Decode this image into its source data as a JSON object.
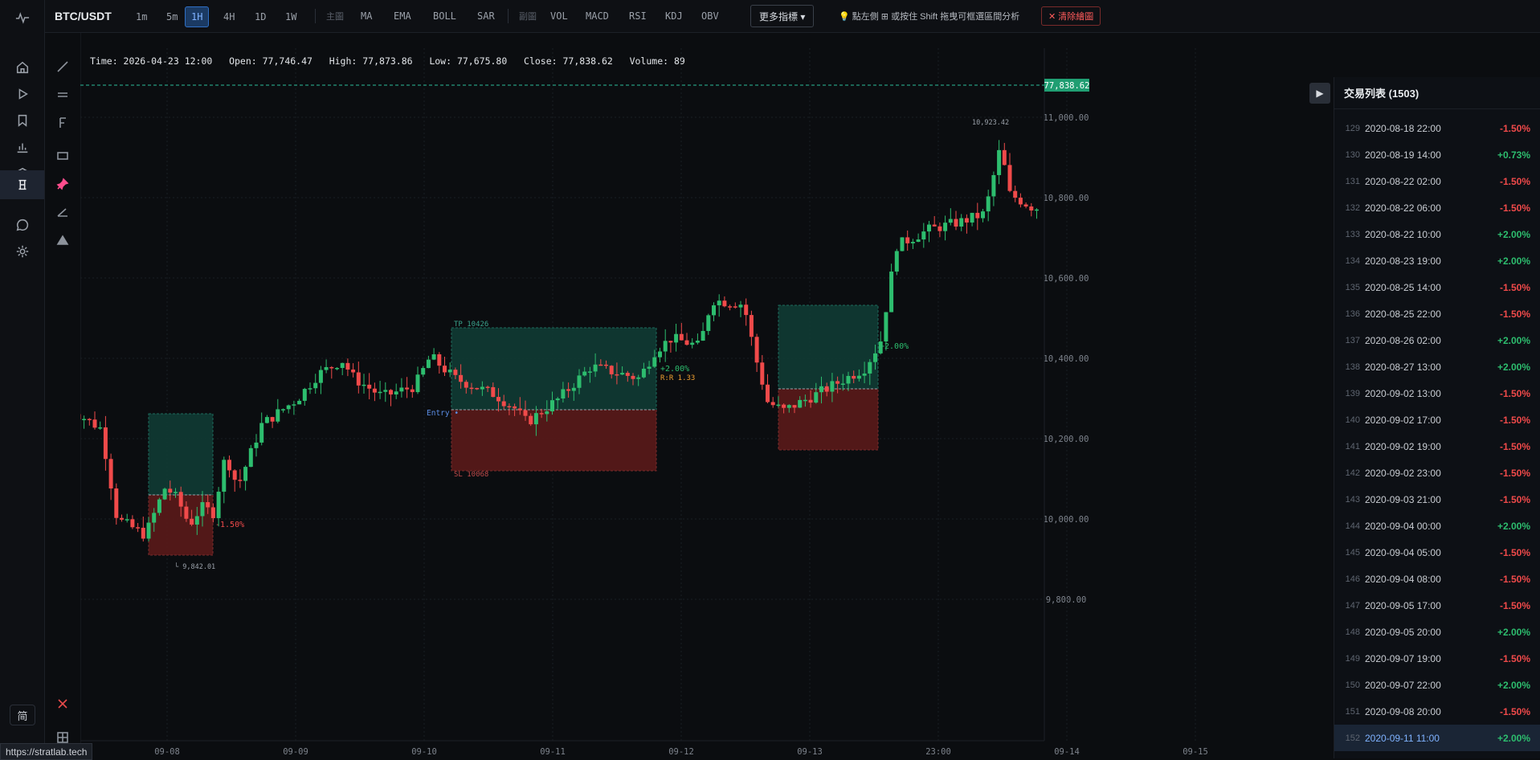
{
  "app": {
    "status_url": "https://stratlab.tech",
    "lang_label": "简"
  },
  "toolbar": {
    "symbol": "BTC/USDT",
    "timeframes": [
      "1m",
      "5m",
      "1H",
      "4H",
      "1D",
      "1W"
    ],
    "active_timeframe": "1H",
    "main_label": "主圖",
    "main_indicators": [
      "MA",
      "EMA",
      "BOLL",
      "SAR"
    ],
    "sub_label": "副圖",
    "sub_indicators": [
      "VOL",
      "MACD",
      "RSI",
      "KDJ",
      "OBV"
    ],
    "more_label": "更多指標 ▾",
    "hint": "💡 點左側 ⊞ 或按住 Shift 拖曳可框選區間分析",
    "clear_label": "✕ 清除繪圖"
  },
  "ohlc_line": "Time: 2026-04-23 12:00   Open: 77,746.47   High: 77,873.86   Low: 77,675.80   Close: 77,838.62   Volume: 89",
  "panel": {
    "title": "交易列表 (1503)",
    "trades": [
      {
        "idx": "129",
        "time": "2020-08-18 22:00",
        "pnl": "-1.50%"
      },
      {
        "idx": "130",
        "time": "2020-08-19 14:00",
        "pnl": "+0.73%"
      },
      {
        "idx": "131",
        "time": "2020-08-22 02:00",
        "pnl": "-1.50%"
      },
      {
        "idx": "132",
        "time": "2020-08-22 06:00",
        "pnl": "-1.50%"
      },
      {
        "idx": "133",
        "time": "2020-08-22 10:00",
        "pnl": "+2.00%"
      },
      {
        "idx": "134",
        "time": "2020-08-23 19:00",
        "pnl": "+2.00%"
      },
      {
        "idx": "135",
        "time": "2020-08-25 14:00",
        "pnl": "-1.50%"
      },
      {
        "idx": "136",
        "time": "2020-08-25 22:00",
        "pnl": "-1.50%"
      },
      {
        "idx": "137",
        "time": "2020-08-26 02:00",
        "pnl": "+2.00%"
      },
      {
        "idx": "138",
        "time": "2020-08-27 13:00",
        "pnl": "+2.00%"
      },
      {
        "idx": "139",
        "time": "2020-09-02 13:00",
        "pnl": "-1.50%"
      },
      {
        "idx": "140",
        "time": "2020-09-02 17:00",
        "pnl": "-1.50%"
      },
      {
        "idx": "141",
        "time": "2020-09-02 19:00",
        "pnl": "-1.50%"
      },
      {
        "idx": "142",
        "time": "2020-09-02 23:00",
        "pnl": "-1.50%"
      },
      {
        "idx": "143",
        "time": "2020-09-03 21:00",
        "pnl": "-1.50%"
      },
      {
        "idx": "144",
        "time": "2020-09-04 00:00",
        "pnl": "+2.00%"
      },
      {
        "idx": "145",
        "time": "2020-09-04 05:00",
        "pnl": "-1.50%"
      },
      {
        "idx": "146",
        "time": "2020-09-04 08:00",
        "pnl": "-1.50%"
      },
      {
        "idx": "147",
        "time": "2020-09-05 17:00",
        "pnl": "-1.50%"
      },
      {
        "idx": "148",
        "time": "2020-09-05 20:00",
        "pnl": "+2.00%"
      },
      {
        "idx": "149",
        "time": "2020-09-07 19:00",
        "pnl": "-1.50%"
      },
      {
        "idx": "150",
        "time": "2020-09-07 22:00",
        "pnl": "+2.00%"
      },
      {
        "idx": "151",
        "time": "2020-09-08 20:00",
        "pnl": "-1.50%"
      },
      {
        "idx": "152",
        "time": "2020-09-11 11:00",
        "pnl": "+2.00%"
      }
    ],
    "selected_idx": "152"
  },
  "chart_data": {
    "type": "candlestick",
    "y_ticks": [
      "11,000.00",
      "10,800.00",
      "10,600.00",
      "10,400.00",
      "10,200.00",
      "10,000.00",
      "9,800.00"
    ],
    "x_ticks": [
      "09-08",
      "09-09",
      "09-10",
      "09-11",
      "09-12",
      "09-13",
      "23:00",
      "09-14",
      "09-15"
    ],
    "last_price_label": "77,838.62",
    "high_marker": "10,923.42",
    "low_marker": "9,842.01",
    "trades": [
      {
        "result": "-1.50%"
      },
      {
        "tp_label": "TP 10426",
        "sl_label": "SL 10068",
        "entry_label": "Entry",
        "result": "+2.00%",
        "rr": "R:R 1.33"
      },
      {
        "result": "+2.00%"
      }
    ]
  },
  "colors": {
    "up": "#2dbd6e",
    "down": "#f04a4a",
    "tp_zone": "#0f3b34",
    "sl_zone": "#5a1a1a",
    "accent": "#2f6fc4"
  }
}
